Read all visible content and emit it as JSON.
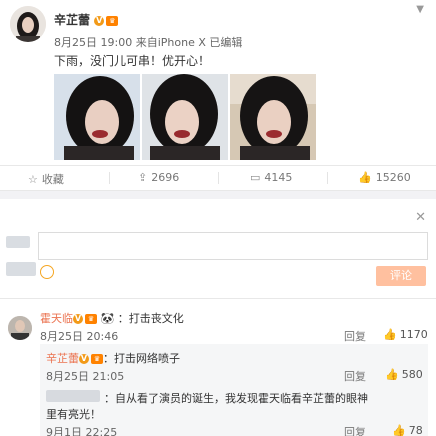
{
  "post": {
    "username": "辛芷蕾",
    "date": "8月25日 19:00",
    "source_prefix": "来自",
    "source": "iPhone X",
    "edited": "已编辑",
    "content": "下雨，没门儿可串！优开心！",
    "caret_icon": "chevron-down-icon"
  },
  "actions": {
    "favorite_label": "收藏",
    "share_count": "2696",
    "comment_count": "4145",
    "like_count": "15260"
  },
  "compose": {
    "submit_label": "评论"
  },
  "comments": [
    {
      "username": "霍天临",
      "text": "：打击丧文化",
      "time": "8月25日 20:46",
      "reply_label": "回复",
      "likes": "1170"
    }
  ],
  "replies": [
    {
      "username": "辛芷蕾",
      "text": "：打击网络喷子",
      "time": "8月25日 21:05",
      "reply_label": "回复",
      "likes": "580"
    },
    {
      "username": "",
      "text": "：自从看了演员的诞生，我发现霍天临看辛芷蕾的眼神",
      "text2": "里有亮光！",
      "time": "9月1日 22:25",
      "reply_label": "回复",
      "likes": "78"
    }
  ],
  "colors": {
    "name_link": "#eb7350",
    "submit_bg": "#ffc09f",
    "verified_badge": "#f29a18"
  }
}
